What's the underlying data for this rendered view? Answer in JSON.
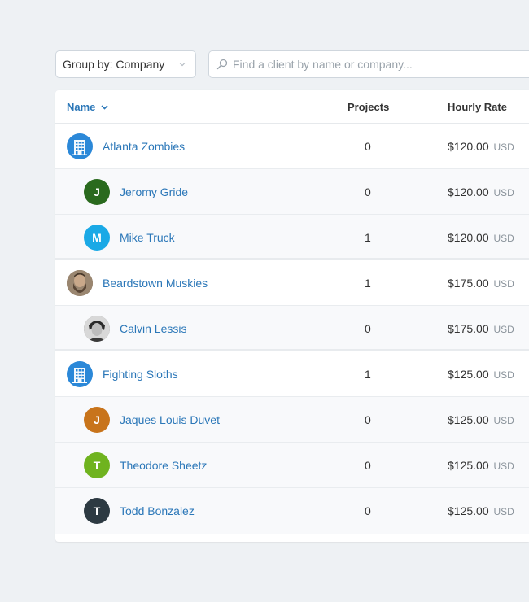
{
  "toolbar": {
    "group_by_label": "Group by: Company",
    "search_placeholder": "Find a client by name or company..."
  },
  "table": {
    "headers": {
      "name": "Name",
      "projects": "Projects",
      "rate": "Hourly Rate"
    },
    "rows": [
      {
        "type": "company",
        "name": "Atlanta Zombies",
        "projects": "0",
        "rate": "$120.00",
        "currency": "USD",
        "avatar": "building-icon"
      },
      {
        "type": "contact",
        "name": "Jeromy Gride",
        "projects": "0",
        "rate": "$120.00",
        "currency": "USD",
        "initial": "J",
        "color": "#2a6a1e"
      },
      {
        "type": "contact",
        "name": "Mike Truck",
        "projects": "1",
        "rate": "$120.00",
        "currency": "USD",
        "initial": "M",
        "color": "#1aa9e6"
      },
      {
        "type": "company",
        "name": "Beardstown Muskies",
        "projects": "1",
        "rate": "$175.00",
        "currency": "USD",
        "avatar": "photo"
      },
      {
        "type": "contact",
        "name": "Calvin Lessis",
        "projects": "0",
        "rate": "$175.00",
        "currency": "USD",
        "avatar": "photo"
      },
      {
        "type": "company",
        "name": "Fighting Sloths",
        "projects": "1",
        "rate": "$125.00",
        "currency": "USD",
        "avatar": "building-icon"
      },
      {
        "type": "contact",
        "name": "Jaques Louis Duvet",
        "projects": "0",
        "rate": "$125.00",
        "currency": "USD",
        "initial": "J",
        "color": "#c8741b"
      },
      {
        "type": "contact",
        "name": "Theodore Sheetz",
        "projects": "0",
        "rate": "$125.00",
        "currency": "USD",
        "initial": "T",
        "color": "#6fb31f"
      },
      {
        "type": "contact",
        "name": "Todd Bonzalez",
        "projects": "0",
        "rate": "$125.00",
        "currency": "USD",
        "initial": "T",
        "color": "#2d3a42"
      }
    ]
  },
  "colors": {
    "link": "#2b77b8",
    "background": "#eef1f4",
    "company_avatar": "#2b88d8"
  }
}
